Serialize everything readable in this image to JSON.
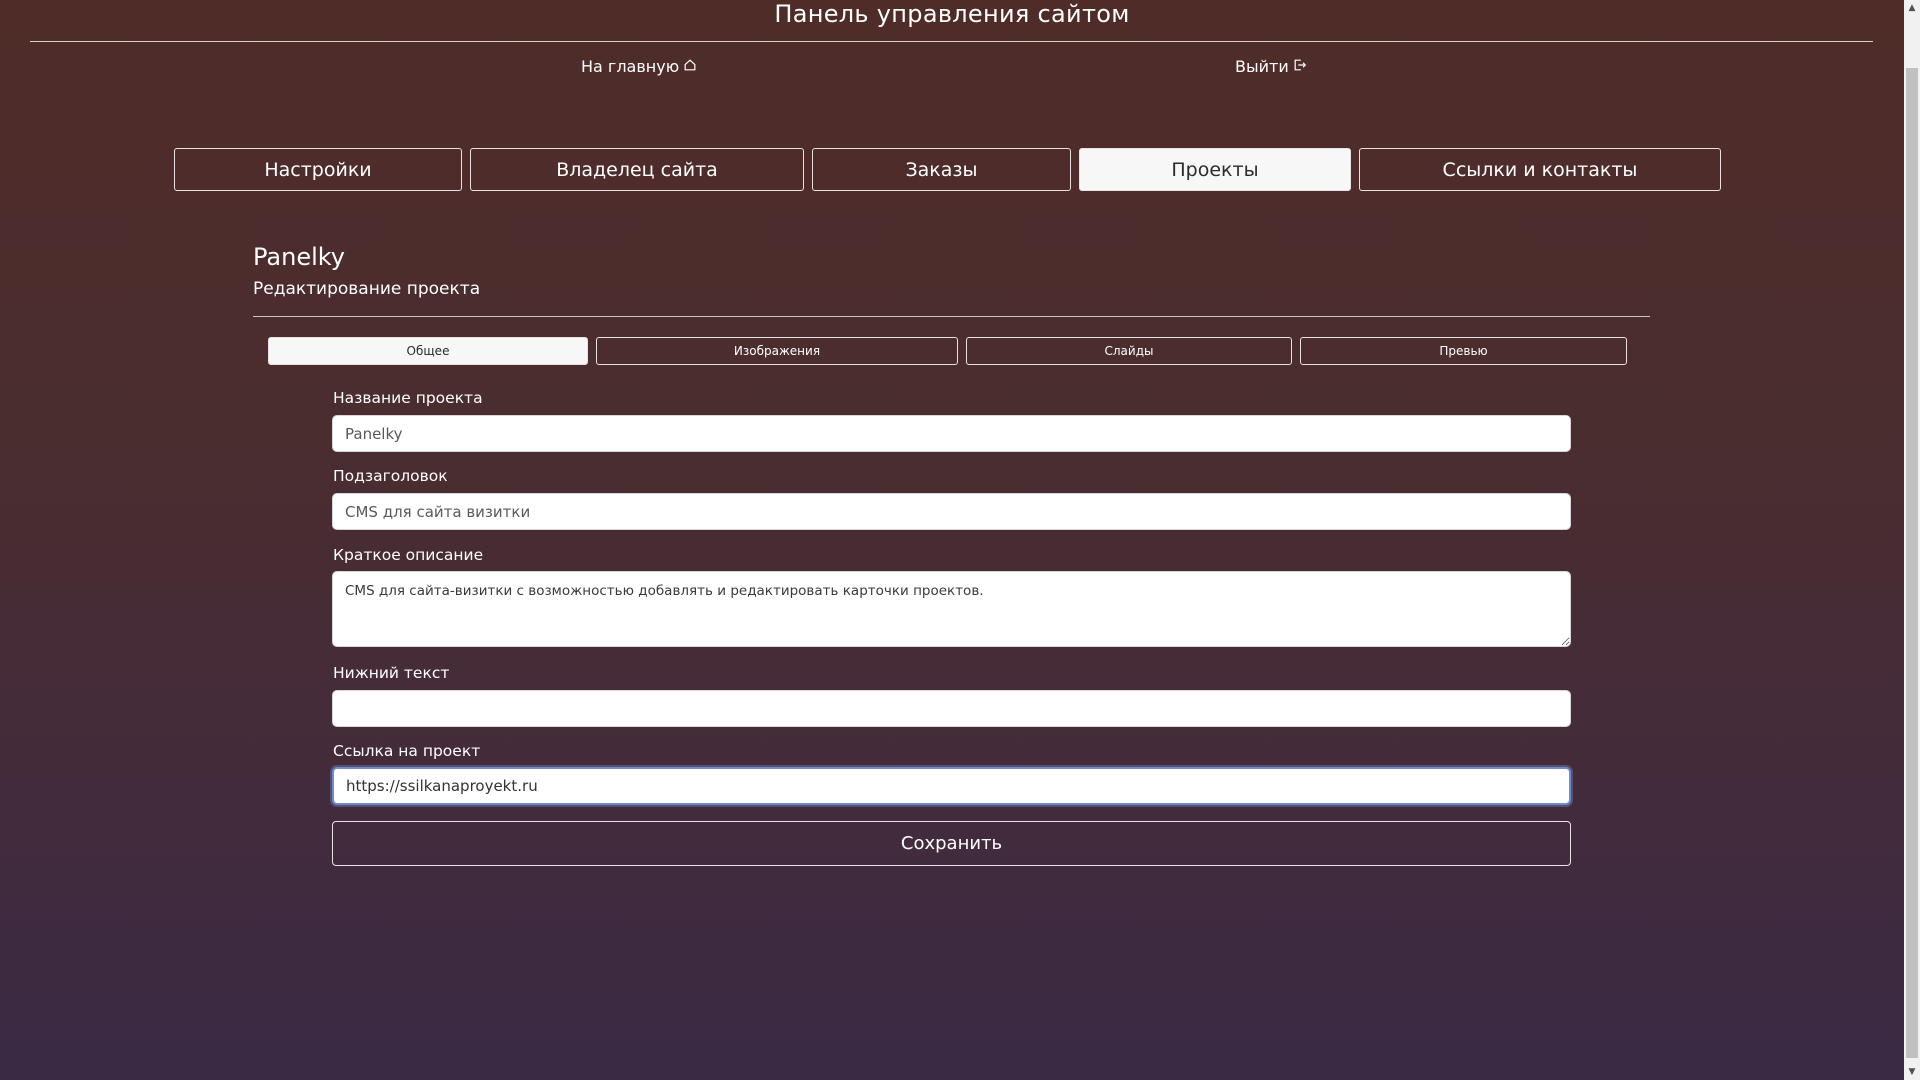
{
  "header": {
    "title": "Панель управления сайтом",
    "home_link": "На главную",
    "logout_link": "Выйти"
  },
  "main_tabs": [
    {
      "label": "Настройки",
      "active": false
    },
    {
      "label": "Владелец сайта",
      "active": false
    },
    {
      "label": "Заказы",
      "active": false
    },
    {
      "label": "Проекты",
      "active": true
    },
    {
      "label": "Ссылки и контакты",
      "active": false
    }
  ],
  "project": {
    "name": "Panelky",
    "subtitle": "Редактирование проекта"
  },
  "sub_tabs": [
    {
      "label": "Общее",
      "active": true
    },
    {
      "label": "Изображения",
      "active": false
    },
    {
      "label": "Слайды",
      "active": false
    },
    {
      "label": "Превью",
      "active": false
    }
  ],
  "form": {
    "name": {
      "label": "Название проекта",
      "value": "Panelky"
    },
    "subtitle": {
      "label": "Подзаголовок",
      "value": "CMS для сайта визитки"
    },
    "description": {
      "label": "Краткое описание",
      "value": "CMS для сайта-визитки с возможностью добавлять и редактировать карточки проектов."
    },
    "footer_text": {
      "label": "Нижний текст",
      "value": ""
    },
    "project_link": {
      "label": "Ссылка на проект",
      "value": "https://ssilkanaproyekt.ru"
    },
    "save_label": "Сохранить"
  },
  "icons": {
    "home": "home-icon",
    "logout": "logout-icon"
  },
  "colors": {
    "background_top": "#4f2c28",
    "background_bottom": "#3a2a44",
    "active_tab": "#f7f7f8",
    "focus_ring": "#6f8cc9"
  }
}
